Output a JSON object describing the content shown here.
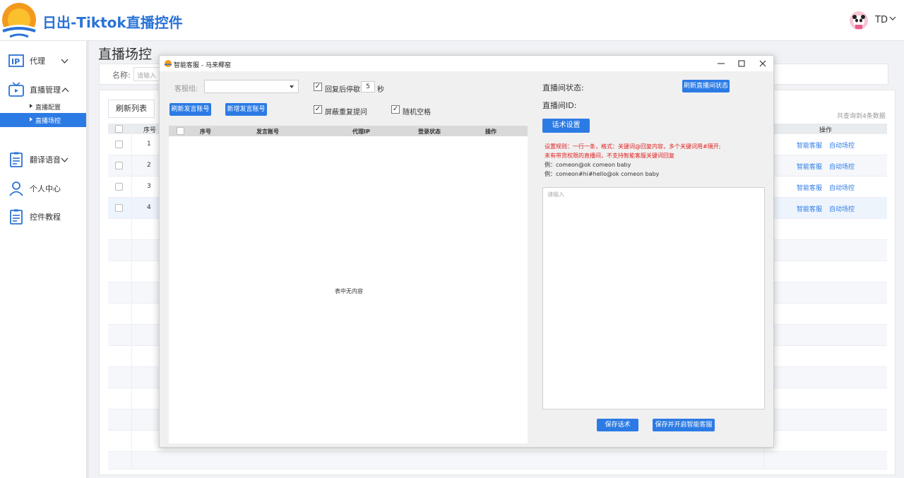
{
  "header": {
    "app_title": "日出-Tiktok直播控件",
    "user_name": "TD"
  },
  "sidebar": {
    "items": [
      {
        "label": "代理",
        "icon": "ip-icon"
      },
      {
        "label": "直播管理",
        "icon": "tv-icon"
      },
      {
        "label": "翻译语音",
        "icon": "document-icon"
      },
      {
        "label": "个人中心",
        "icon": "person-icon"
      },
      {
        "label": "控件教程",
        "icon": "document-icon"
      }
    ],
    "sub_items": [
      {
        "label": "直播配置"
      },
      {
        "label": "直播场控"
      }
    ]
  },
  "main": {
    "page_title": "直播场控",
    "filter_label": "名称:",
    "filter_placeholder": "请输入",
    "refresh_list_label": "刷新列表",
    "total_text": "共查询到4条数据",
    "header_seq": "序号",
    "header_ops": "操作",
    "rows": [
      {
        "seq": "1",
        "link1": "智能客服",
        "link2": "自动场控"
      },
      {
        "seq": "2",
        "link1": "智能客服",
        "link2": "自动场控"
      },
      {
        "seq": "3",
        "link1": "智能客服",
        "link2": "自动场控"
      },
      {
        "seq": "4",
        "link1": "智能客服",
        "link2": "自动场控"
      }
    ]
  },
  "dialog": {
    "title": "智能客服 - 马来椰窑",
    "group_label": "客服组:",
    "stop_after_reply_label": "回复后停歇",
    "stop_seconds": "5",
    "seconds_unit": "秒",
    "refresh_accounts_label": "刷新发言账号",
    "add_account_label": "新增发言账号",
    "block_repeat_label": "屏蔽重复提问",
    "random_space_label": "随机空格",
    "table_headers": [
      "序号",
      "发言账号",
      "代理IP",
      "登录状态",
      "操作"
    ],
    "empty_text": "表中无内容",
    "live_status_label": "直播间状态:",
    "refresh_status_label": "刷新直播间状态",
    "live_id_label": "直播间ID:",
    "script_settings_label": "话术设置",
    "rule_line1": "设置规则：一行一条，格式：关键词@回复内容，多个关键词用#隔开;",
    "rule_line2": "未有带货权限的直播间，不支持智能客服关键词回复",
    "example1": "例：comeon@ok comeon baby",
    "example2": "例：comeon#hi#hello@ok comeon baby",
    "textarea_placeholder": "请输入",
    "save_script_label": "保存话术",
    "save_start_label": "保存并开启智能客服"
  },
  "colors": {
    "accent": "#2c7be5",
    "brand_title": "#2a73d6",
    "warning_text": "#e02020"
  }
}
